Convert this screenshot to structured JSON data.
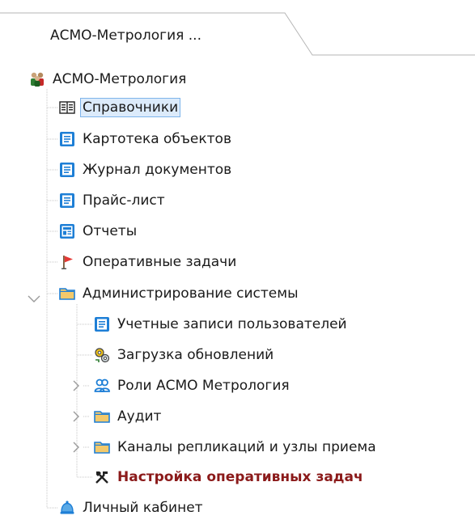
{
  "tab": {
    "title": "АСМО-Метрология ..."
  },
  "tree": {
    "root": {
      "label": "АСМО-Метрология",
      "icon": "users-group-icon"
    },
    "items": [
      {
        "label": "Справочники",
        "icon": "book-icon",
        "selected": true
      },
      {
        "label": "Картотека объектов",
        "icon": "document-list-icon"
      },
      {
        "label": "Журнал документов",
        "icon": "document-list-icon"
      },
      {
        "label": "Прайс-лист",
        "icon": "document-list-icon"
      },
      {
        "label": "Отчеты",
        "icon": "report-icon"
      },
      {
        "label": "Оперативные задачи",
        "icon": "flag-icon"
      },
      {
        "label": "Администрирование системы",
        "icon": "folder-icon",
        "expanded": true
      },
      {
        "label": "Учетные записи пользователей",
        "icon": "document-list-icon"
      },
      {
        "label": "Загрузка обновлений",
        "icon": "update-gears-icon"
      },
      {
        "label": "Роли АСМО Метрология",
        "icon": "roles-icon",
        "collapsed": true
      },
      {
        "label": "Аудит",
        "icon": "folder-icon",
        "collapsed": true
      },
      {
        "label": "Каналы репликаций и узлы приема",
        "icon": "folder-icon",
        "collapsed": true
      },
      {
        "label": "Настройка оперативных задач",
        "icon": "tools-icon",
        "bold": true,
        "color": "#8b1a1a"
      },
      {
        "label": "Личный кабинет",
        "icon": "bell-icon"
      }
    ]
  },
  "colors": {
    "selection_bg": "#dcebfb",
    "selection_border": "#7eb4ea",
    "accent_text": "#8b1a1a",
    "icon_blue": "#1e7fd6",
    "folder": "#f3c96b"
  }
}
